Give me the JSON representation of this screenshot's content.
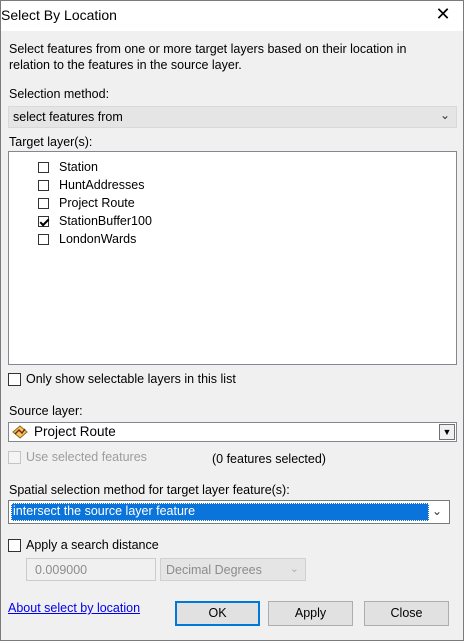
{
  "window": {
    "title": "Select By Location",
    "close_glyph": "✕"
  },
  "description": "Select features from one or more target layers based on their location in relation to the features in the source layer.",
  "selection_method": {
    "label": "Selection method:",
    "value": "select features from"
  },
  "target_layers": {
    "label": "Target layer(s):",
    "items": [
      {
        "label": "Station",
        "checked": false
      },
      {
        "label": "HuntAddresses",
        "checked": false
      },
      {
        "label": "Project Route",
        "checked": false
      },
      {
        "label": "StationBuffer100",
        "checked": true
      },
      {
        "label": "LondonWards",
        "checked": false
      }
    ]
  },
  "only_selectable": {
    "label": "Only show selectable layers in this list",
    "checked": false
  },
  "source_layer": {
    "label": "Source layer:",
    "value": "Project Route",
    "icon": "polyline-layer-icon"
  },
  "use_selected": {
    "label": "Use selected features",
    "checked": false,
    "count_text": "(0 features selected)"
  },
  "spatial_method": {
    "label": "Spatial selection method for target layer feature(s):",
    "value": "intersect the source layer feature"
  },
  "search_distance": {
    "label": "Apply a search distance",
    "checked": false,
    "value": "0.009000",
    "unit": "Decimal Degrees"
  },
  "footer": {
    "help_link": "About select by location",
    "ok": "OK",
    "apply": "Apply",
    "close": "Close"
  },
  "colors": {
    "selection_highlight": "#0a74da",
    "link": "#0000ee",
    "default_button_border": "#0078d7"
  }
}
